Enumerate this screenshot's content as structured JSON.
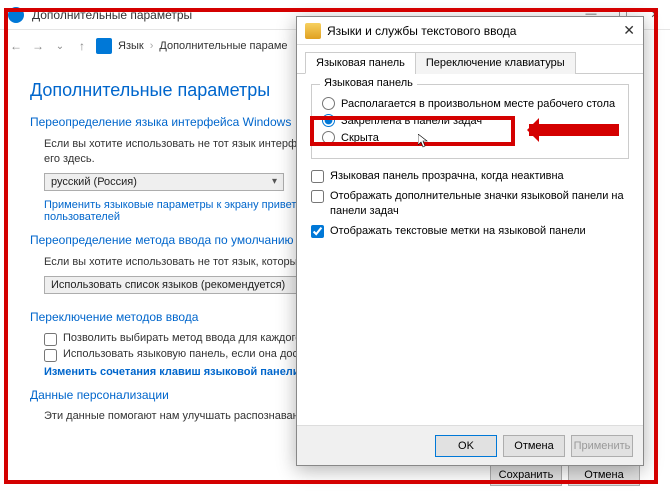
{
  "window": {
    "title": "Дополнительные параметры",
    "controls": {
      "min": "—",
      "max": "☐",
      "close": "✕"
    }
  },
  "nav": {
    "back": "←",
    "fwd": "→",
    "up": "↑",
    "crumb1": "Язык",
    "sep": "›",
    "crumb2": "Дополнительные параме"
  },
  "page": {
    "heading": "Дополнительные параметры",
    "sec1": "Переопределение языка интерфейса Windows",
    "sec1_desc": "Если вы хотите использовать не тот язык интерфейса, который находится вверху вашего списка языков, выберите его здесь.",
    "combo1": "русский (Россия)",
    "link1": "Применить языковые параметры к экрану приветствия, системным учётным записям и новым учётным записям пользователей",
    "sec2": "Переопределение метода ввода по умолчанию",
    "sec2_desc": "Если вы хотите использовать не тот язык, который находится вверху вашего списка языков, выберите его здесь.",
    "combo2": "Использовать список языков (рекомендуется)",
    "sec3": "Переключение методов ввода",
    "chk3a": "Позволить выбирать метод ввода для каждого приложения",
    "chk3b": "Использовать языковую панель, если она доступна",
    "link3": "Изменить сочетания клавиш языковой панели",
    "sec4": "Данные персонализации",
    "sec4_desc": "Эти данные помогают нам улучшать распознавание рукописного ввода и прогнозирование текста",
    "btn_save": "Сохранить",
    "btn_cancel": "Отмена"
  },
  "dialog": {
    "title": "Языки и службы текстового ввода",
    "close": "✕",
    "tab1": "Языковая панель",
    "tab2": "Переключение клавиатуры",
    "group_title": "Языковая панель",
    "rad1": "Располагается в произвольном месте рабочего стола",
    "rad2": "Закреплена в панели задач",
    "rad3": "Скрыта",
    "chk1": "Языковая панель прозрачна, когда неактивна",
    "chk2": "Отображать дополнительные значки языковой панели на панели задач",
    "chk3": "Отображать текстовые метки на языковой панели",
    "btn_ok": "OK",
    "btn_cancel": "Отмена",
    "btn_apply": "Применить"
  }
}
